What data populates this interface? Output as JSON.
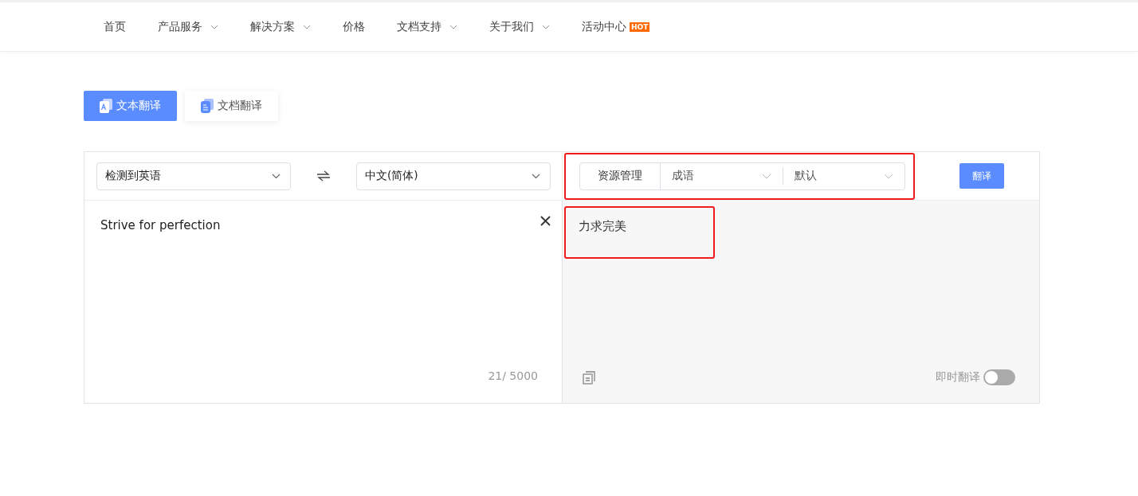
{
  "nav": {
    "items": [
      {
        "label": "首页",
        "has_caret": false
      },
      {
        "label": "产品服务",
        "has_caret": true
      },
      {
        "label": "解决方案",
        "has_caret": true
      },
      {
        "label": "价格",
        "has_caret": false
      },
      {
        "label": "文档支持",
        "has_caret": true
      },
      {
        "label": "关于我们",
        "has_caret": true
      },
      {
        "label": "活动中心",
        "has_caret": false,
        "badge": "HOT"
      }
    ]
  },
  "mode_tabs": [
    {
      "label": "文本翻译",
      "kind": "text",
      "selected": true
    },
    {
      "label": "文档翻译",
      "kind": "document",
      "selected": false
    }
  ],
  "source_language": "检测到英语",
  "target_language": "中文(简体)",
  "resource_bar": {
    "label": "资源管理",
    "term_dropdown": "成语",
    "style_dropdown": "默认",
    "highlighted": true
  },
  "translate_button": "翻译",
  "input": {
    "value": "Strive for perfection",
    "counter": "21/ 5000"
  },
  "output": {
    "text": "力求完美",
    "highlighted": true
  },
  "instant_translate": {
    "label": "即时翻译",
    "on": false
  }
}
